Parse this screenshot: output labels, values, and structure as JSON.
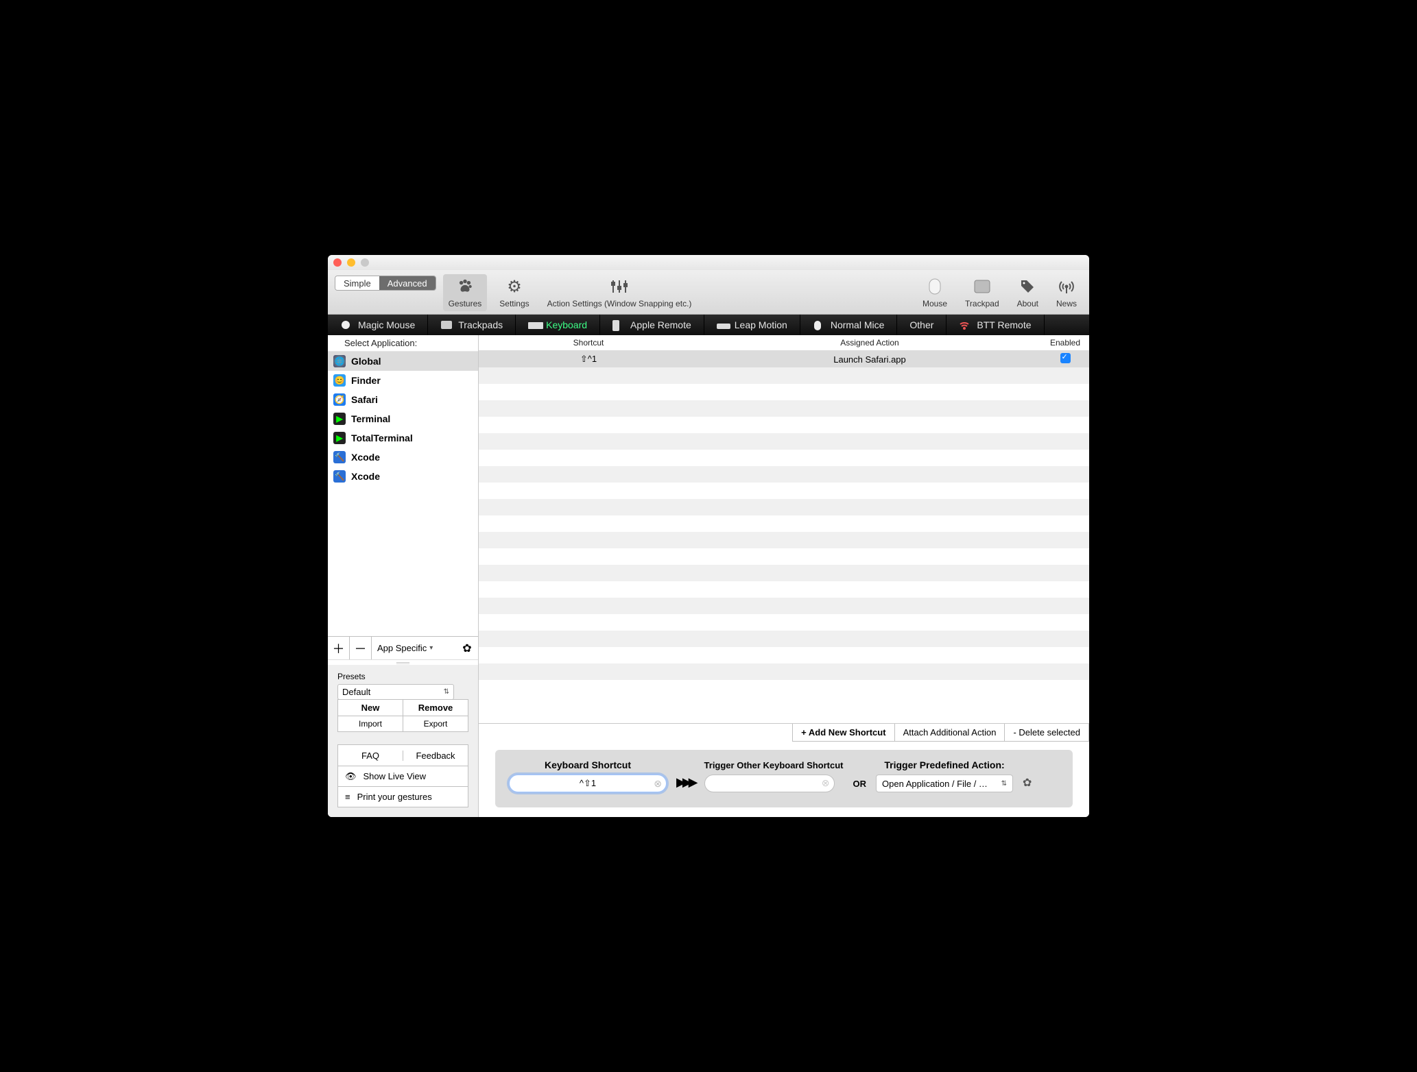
{
  "toolbar": {
    "mode_simple": "Simple",
    "mode_advanced": "Advanced",
    "items_left": [
      {
        "label": "Gestures"
      },
      {
        "label": "Settings"
      },
      {
        "label": "Action Settings (Window Snapping etc.)"
      }
    ],
    "items_right": [
      {
        "label": "Mouse"
      },
      {
        "label": "Trackpad"
      },
      {
        "label": "About"
      },
      {
        "label": "News"
      }
    ]
  },
  "device_tabs": [
    {
      "label": "Magic Mouse"
    },
    {
      "label": "Trackpads"
    },
    {
      "label": "Keyboard",
      "active": true
    },
    {
      "label": "Apple Remote"
    },
    {
      "label": "Leap Motion"
    },
    {
      "label": "Normal Mice"
    },
    {
      "label": "Other"
    },
    {
      "label": "BTT Remote"
    }
  ],
  "sidebar": {
    "header": "Select Application:",
    "apps": [
      {
        "name": "Global",
        "selected": true,
        "color": "#6c6c8a"
      },
      {
        "name": "Finder",
        "color": "#2a9df4"
      },
      {
        "name": "Safari",
        "color": "#1e7cf0"
      },
      {
        "name": "Terminal",
        "color": "#222"
      },
      {
        "name": "TotalTerminal",
        "color": "#222"
      },
      {
        "name": "Xcode",
        "color": "#2a6fd6"
      },
      {
        "name": "Xcode",
        "color": "#2a6fd6"
      }
    ],
    "app_specific": "App Specific"
  },
  "presets": {
    "label": "Presets",
    "selected": "Default",
    "new": "New",
    "remove": "Remove",
    "import": "Import",
    "export": "Export"
  },
  "links": {
    "faq": "FAQ",
    "feedback": "Feedback",
    "live": "Show Live View",
    "print": "Print your gestures"
  },
  "columns": {
    "shortcut": "Shortcut",
    "action": "Assigned Action",
    "enabled": "Enabled"
  },
  "row": {
    "shortcut": "⇧^1",
    "action": "Launch Safari.app"
  },
  "actionbar": {
    "add": "+ Add New Shortcut",
    "attach": "Attach Additional Action",
    "delete": "- Delete selected"
  },
  "bottom": {
    "ks_title": "Keyboard Shortcut",
    "ks_value": "^⇧1",
    "trig_title": "Trigger Other Keyboard Shortcut",
    "or": "OR",
    "predef_title": "Trigger Predefined Action:",
    "predef_value": "Open Application / File / …"
  }
}
